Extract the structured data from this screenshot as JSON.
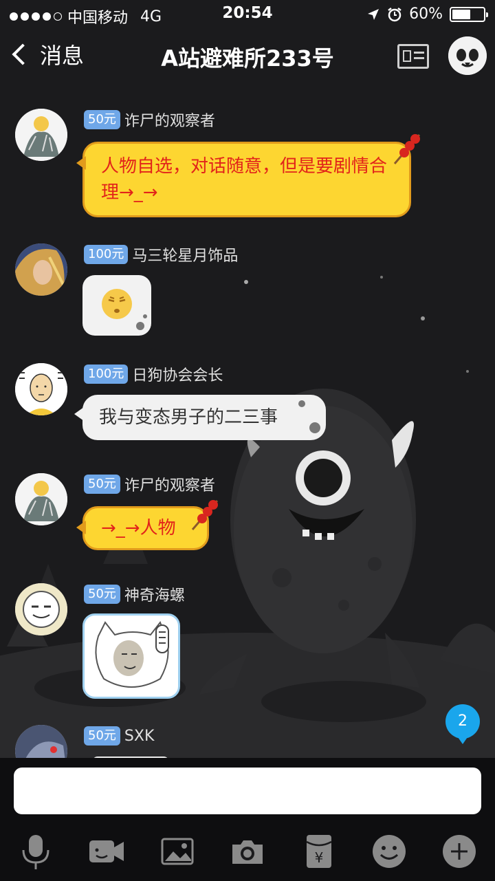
{
  "status_bar": {
    "carrier": "中国移动",
    "network": "4G",
    "time": "20:54",
    "battery": "60%",
    "battery_level": 0.6
  },
  "header": {
    "back_label": "消息",
    "title": "A站避难所233号"
  },
  "messages": [
    {
      "badge": "50元",
      "name": "诈尸的观察者",
      "text": "人物自选，对话随意，但是要剧情合理→_→",
      "style": "yellow"
    },
    {
      "badge": "100元",
      "name": "马三轮星月饰品",
      "text": "",
      "style": "sticker-emoji"
    },
    {
      "badge": "100元",
      "name": "日狗协会会长",
      "text": "我与变态男子的二三事",
      "style": "white"
    },
    {
      "badge": "50元",
      "name": "诈尸的观察者",
      "text": "→_→人物",
      "style": "yellow"
    },
    {
      "badge": "50元",
      "name": "神奇海螺",
      "text": "",
      "style": "sticker-cat"
    },
    {
      "badge": "50元",
      "name": "SXK",
      "text": "",
      "style": "partial"
    }
  ],
  "unread_count": "2",
  "input": {
    "placeholder": ""
  },
  "toolbar": [
    "mic-icon",
    "video-icon",
    "image-icon",
    "camera-icon",
    "red-packet-icon",
    "emoji-icon",
    "plus-icon"
  ],
  "colors": {
    "background": "#1b1b1d",
    "badge": "#6fa7e8",
    "bubble_yellow": "#fdd631",
    "bubble_yellow_text": "#e2231a",
    "unread": "#1aa6ec"
  }
}
